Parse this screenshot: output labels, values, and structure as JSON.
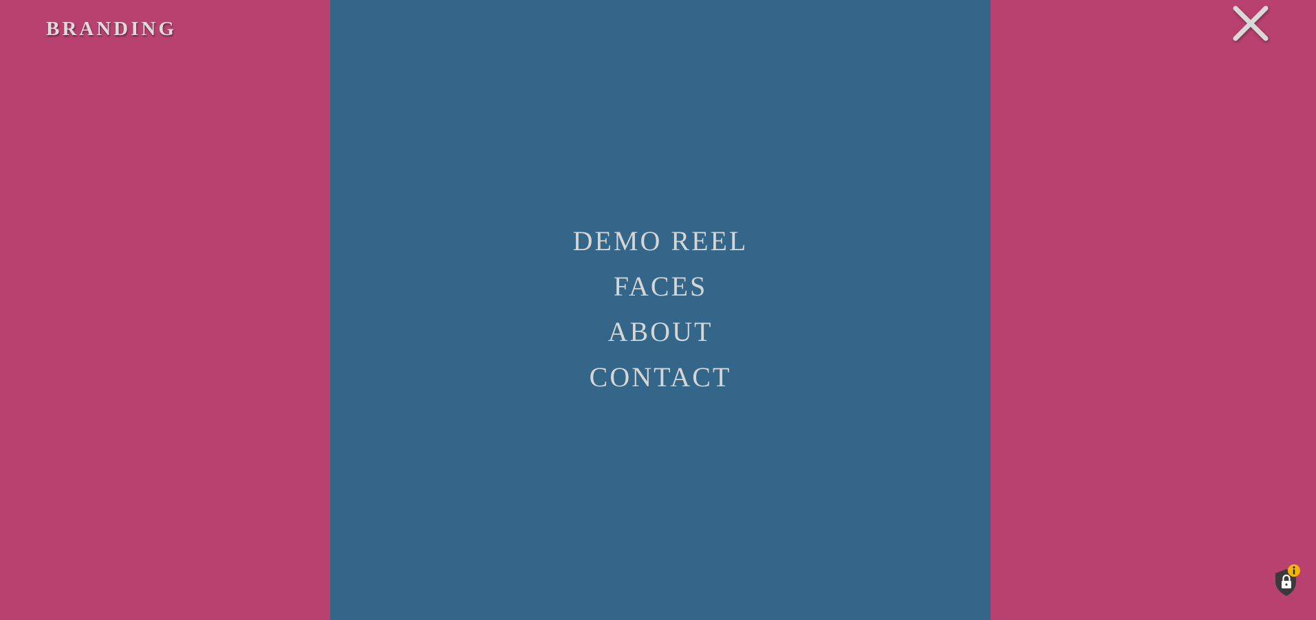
{
  "header": {
    "brand": "BRANDING",
    "close_icon": "close-icon"
  },
  "menu": {
    "items": [
      {
        "label": "DEMO REEL"
      },
      {
        "label": "FACES"
      },
      {
        "label": "ABOUT"
      },
      {
        "label": "CONTACT"
      }
    ]
  },
  "privacy_widget": {
    "icon": "shield-lock-icon",
    "badge_icon": "info-icon"
  },
  "colors": {
    "side_panels": "#b94170",
    "center_panel": "#336688",
    "text": "#d6d6d6",
    "badge": "#f5b400"
  }
}
